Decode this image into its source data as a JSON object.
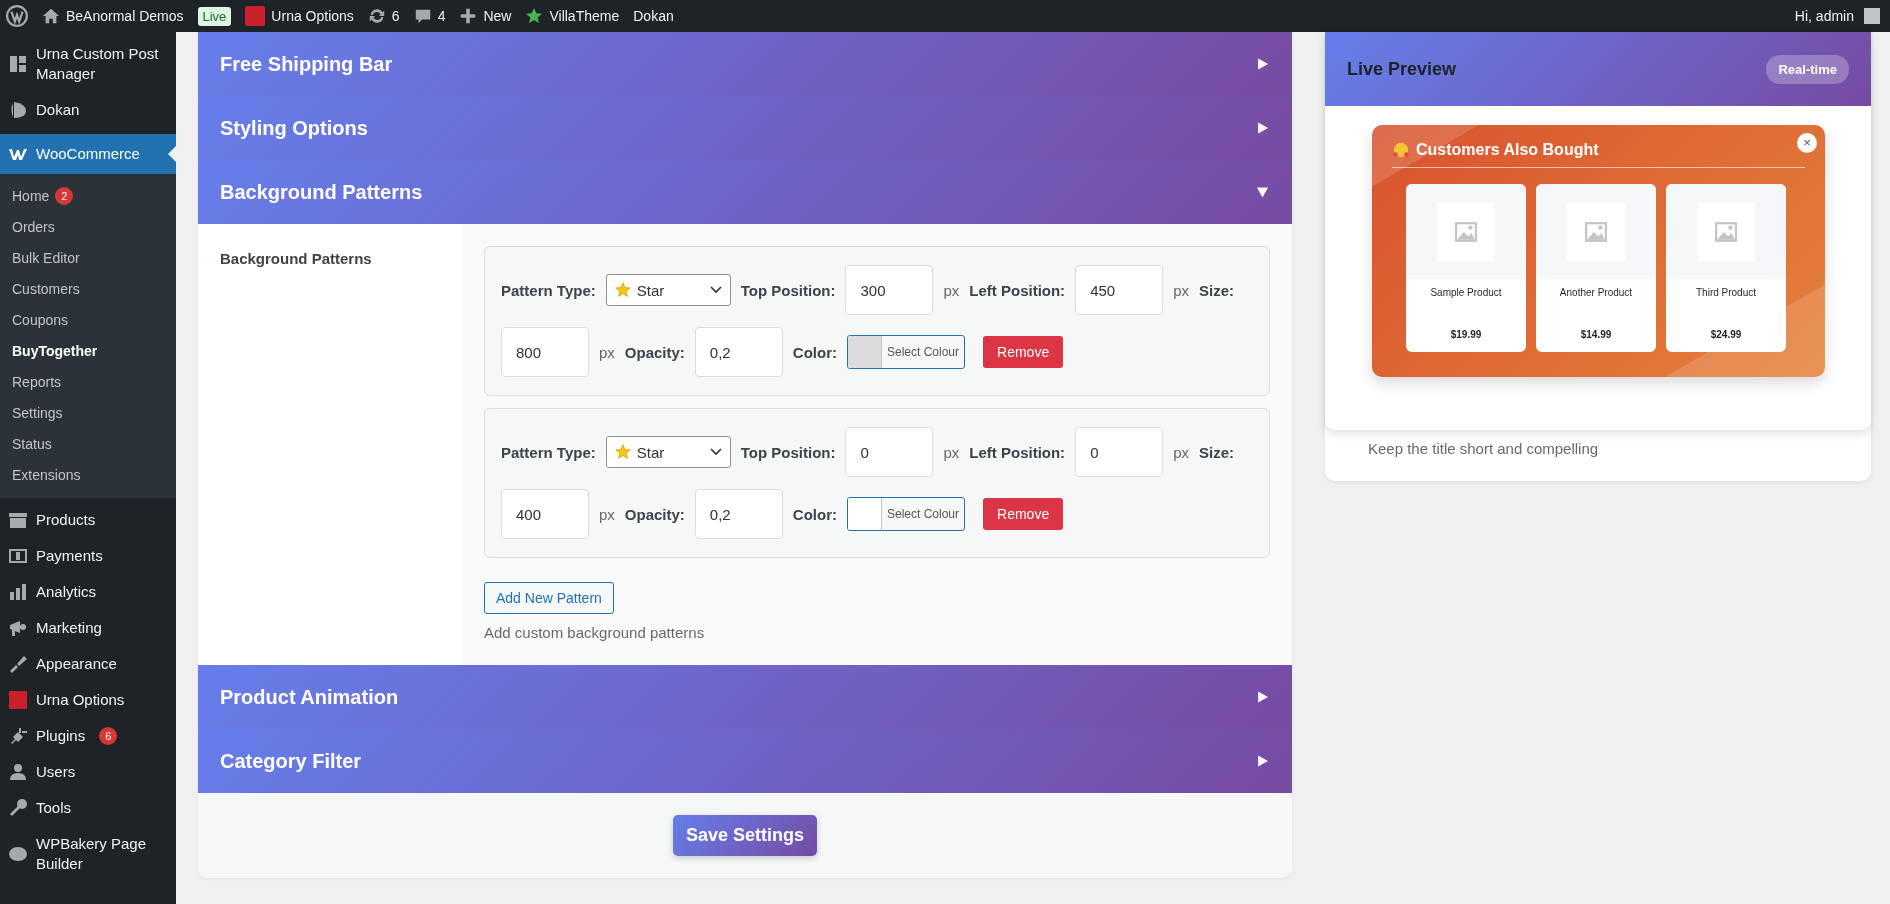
{
  "admin_bar": {
    "items": [
      {
        "kind": "wp"
      },
      {
        "kind": "home",
        "label": "BeAnormal Demos"
      },
      {
        "kind": "live",
        "label": "Live"
      },
      {
        "kind": "urna",
        "label": "Urna Options"
      },
      {
        "kind": "updates",
        "label": "6"
      },
      {
        "kind": "comments",
        "label": "4"
      },
      {
        "kind": "new",
        "label": "New"
      },
      {
        "kind": "star",
        "label": "VillaTheme"
      },
      {
        "kind": "text",
        "label": "Dokan"
      }
    ],
    "greeting": "Hi, admin"
  },
  "sidebar": {
    "items": [
      {
        "label": "Urna Custom Post Manager",
        "selected": false
      },
      {
        "label": "Dokan",
        "selected": false
      },
      {
        "label": "WooCommerce",
        "selected": true,
        "children": [
          {
            "label": "Home",
            "badge": "2",
            "selected": false
          },
          {
            "label": "Orders",
            "selected": false
          },
          {
            "label": "Bulk Editor",
            "selected": false
          },
          {
            "label": "Customers",
            "selected": false
          },
          {
            "label": "Coupons",
            "selected": false
          },
          {
            "label": "BuyTogether",
            "selected": true
          },
          {
            "label": "Reports",
            "selected": false
          },
          {
            "label": "Settings",
            "selected": false
          },
          {
            "label": "Status",
            "selected": false
          },
          {
            "label": "Extensions",
            "selected": false
          }
        ]
      },
      {
        "label": "Products",
        "selected": false
      },
      {
        "label": "Payments",
        "selected": false
      },
      {
        "label": "Analytics",
        "selected": false
      },
      {
        "label": "Marketing",
        "selected": false
      },
      {
        "label": "Appearance",
        "selected": false
      },
      {
        "label": "Urna Options",
        "selected": false
      },
      {
        "label": "Plugins",
        "selected": false,
        "badge": "6"
      },
      {
        "label": "Users",
        "selected": false
      },
      {
        "label": "Tools",
        "selected": false
      },
      {
        "label": "WPBakery Page Builder",
        "selected": false
      }
    ]
  },
  "sections": [
    {
      "title": "Free Shipping Bar",
      "expanded": false
    },
    {
      "title": "Styling Options",
      "expanded": false
    },
    {
      "title": "Background Patterns",
      "expanded": true,
      "field_label": "Background Patterns",
      "patterns": [
        {
          "fields": [
            {
              "kind": "select",
              "label": "Pattern Type:",
              "value": "Star"
            },
            {
              "kind": "number",
              "label": "Top Position:",
              "value": "300",
              "unit": "px"
            },
            {
              "kind": "number",
              "label": "Left Position:",
              "value": "450",
              "unit": "px"
            },
            {
              "kind": "number",
              "label": "Size:",
              "value": "800",
              "unit": "px"
            },
            {
              "kind": "number",
              "label": "Opacity:",
              "value": "0,2"
            },
            {
              "kind": "color",
              "label": "Color:",
              "button": "Select Colour",
              "color": "#dcdcde"
            }
          ],
          "remove": "Remove"
        },
        {
          "fields": [
            {
              "kind": "select",
              "label": "Pattern Type:",
              "value": "Star"
            },
            {
              "kind": "number",
              "label": "Top Position:",
              "value": "0",
              "unit": "px"
            },
            {
              "kind": "number",
              "label": "Left Position:",
              "value": "0",
              "unit": "px"
            },
            {
              "kind": "number",
              "label": "Size:",
              "value": "400",
              "unit": "px"
            },
            {
              "kind": "number",
              "label": "Opacity:",
              "value": "0,2"
            },
            {
              "kind": "color",
              "label": "Color:",
              "button": "Select Colour",
              "color": "#ffffff"
            }
          ],
          "remove": "Remove"
        }
      ],
      "add_button": "Add New Pattern",
      "help": "Add custom background patterns"
    },
    {
      "title": "Product Animation",
      "expanded": false
    },
    {
      "title": "Category Filter",
      "expanded": false
    }
  ],
  "save_button": "Save Settings",
  "preview": {
    "title": "Live Preview",
    "badge": "Real-time",
    "popup": {
      "title": "Customers Also Bought",
      "close": "×",
      "products": [
        {
          "name": "Sample Product",
          "price": "$19.99"
        },
        {
          "name": "Another Product",
          "price": "$14.99"
        },
        {
          "name": "Third Product",
          "price": "$24.99"
        }
      ]
    },
    "hint": "Keep the title short and compelling"
  }
}
